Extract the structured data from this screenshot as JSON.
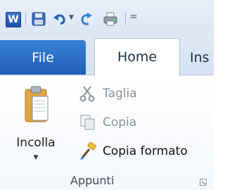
{
  "quick_access": {
    "app_icon_letter": "W",
    "buttons": [
      "save-icon",
      "undo-icon",
      "redo-icon",
      "print-preview-icon"
    ],
    "overflow_glyph": "="
  },
  "tabs": {
    "file": "File",
    "home": "Home",
    "insert_partial": "Ins"
  },
  "clipboard_group": {
    "paste_label": "Incolla",
    "cut_label": "Taglia",
    "copy_label": "Copia",
    "format_painter_label": "Copia formato",
    "group_name": "Appunti"
  },
  "colors": {
    "file_tab": "#2b6cc4",
    "ribbon_bg": "#ffffff",
    "disabled_text": "#8a8f96"
  }
}
